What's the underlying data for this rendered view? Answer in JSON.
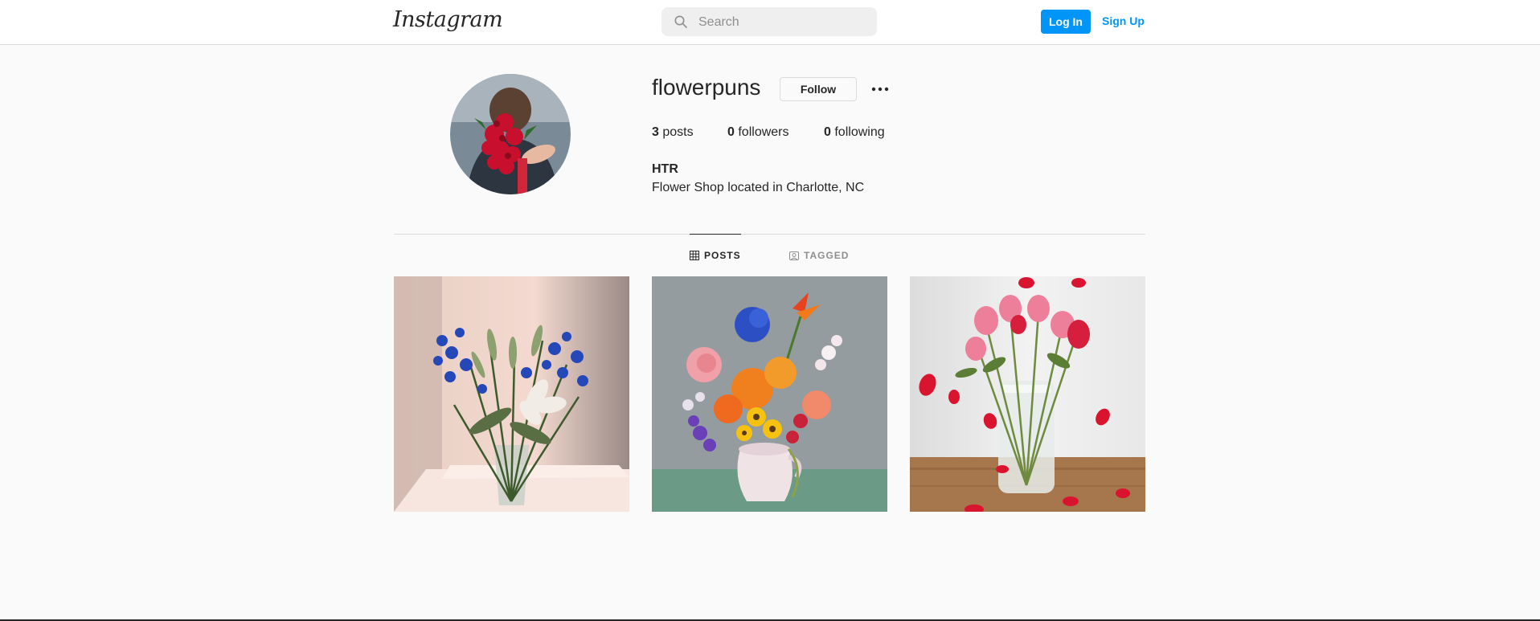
{
  "header": {
    "logo_text": "Instagram",
    "search_placeholder": "Search",
    "login_label": "Log In",
    "signup_label": "Sign Up"
  },
  "profile": {
    "username": "flowerpuns",
    "follow_label": "Follow",
    "posts_count": "3",
    "posts_label": "posts",
    "followers_count": "0",
    "followers_label": "followers",
    "following_count": "0",
    "following_label": "following",
    "full_name": "HTR",
    "bio": "Flower Shop located in Charlotte, NC"
  },
  "tabs": [
    {
      "label": "POSTS",
      "icon": "grid-icon",
      "active": true
    },
    {
      "label": "TAGGED",
      "icon": "tagged-icon",
      "active": false
    }
  ],
  "colors": {
    "accent": "#0095f6",
    "background": "#fafafa",
    "text": "#262626",
    "muted": "#8e8e8e",
    "border": "#dbdbdb"
  }
}
